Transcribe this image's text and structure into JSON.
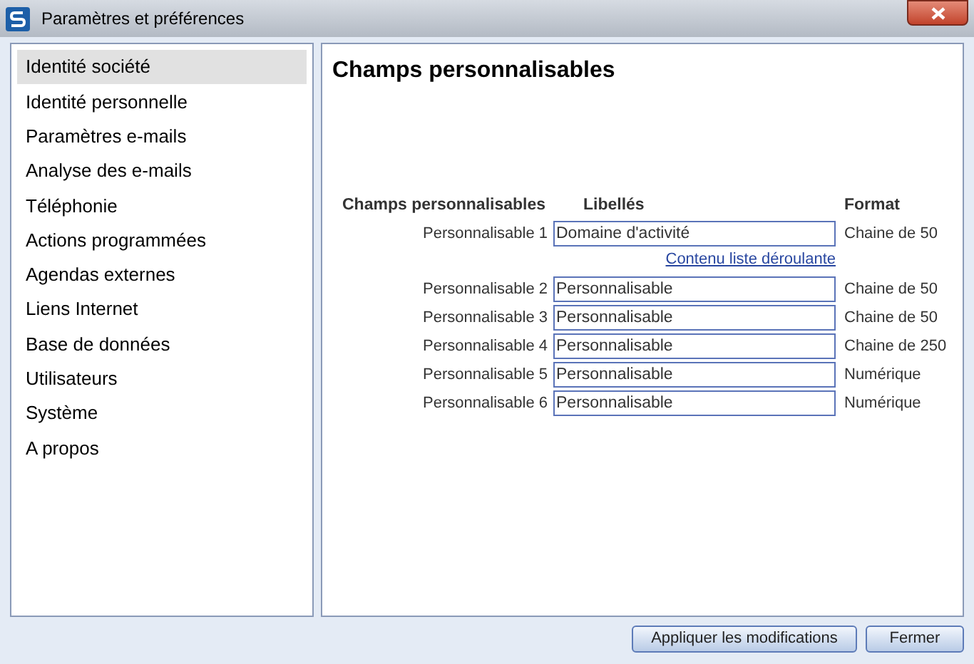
{
  "window": {
    "title": "Paramètres et préférences"
  },
  "sidebar": {
    "items": [
      {
        "label": "Identité société",
        "selected": true
      },
      {
        "label": "Identité personnelle",
        "selected": false
      },
      {
        "label": "Paramètres e-mails",
        "selected": false
      },
      {
        "label": "Analyse des e-mails",
        "selected": false
      },
      {
        "label": "Téléphonie",
        "selected": false
      },
      {
        "label": "Actions programmées",
        "selected": false
      },
      {
        "label": "Agendas externes",
        "selected": false
      },
      {
        "label": "Liens Internet",
        "selected": false
      },
      {
        "label": "Base de données",
        "selected": false
      },
      {
        "label": "Utilisateurs",
        "selected": false
      },
      {
        "label": "Système",
        "selected": false
      },
      {
        "label": "A propos",
        "selected": false
      }
    ]
  },
  "content": {
    "title": "Champs personnalisables",
    "columns": [
      "Champs personnalisables",
      "Libellés",
      "Format"
    ],
    "rows": [
      {
        "name": "Personnalisable 1",
        "value": "Domaine d'activité",
        "format": "Chaine de 50",
        "link": "Contenu liste déroulante"
      },
      {
        "name": "Personnalisable 2",
        "value": "Personnalisable",
        "format": "Chaine de 50"
      },
      {
        "name": "Personnalisable 3",
        "value": "Personnalisable",
        "format": "Chaine de 50"
      },
      {
        "name": "Personnalisable 4",
        "value": "Personnalisable",
        "format": "Chaine de 250"
      },
      {
        "name": "Personnalisable 5",
        "value": "Personnalisable",
        "format": "Numérique"
      },
      {
        "name": "Personnalisable 6",
        "value": "Personnalisable",
        "format": "Numérique"
      }
    ]
  },
  "buttons": [
    "Appliquer les modifications",
    "Fermer"
  ]
}
